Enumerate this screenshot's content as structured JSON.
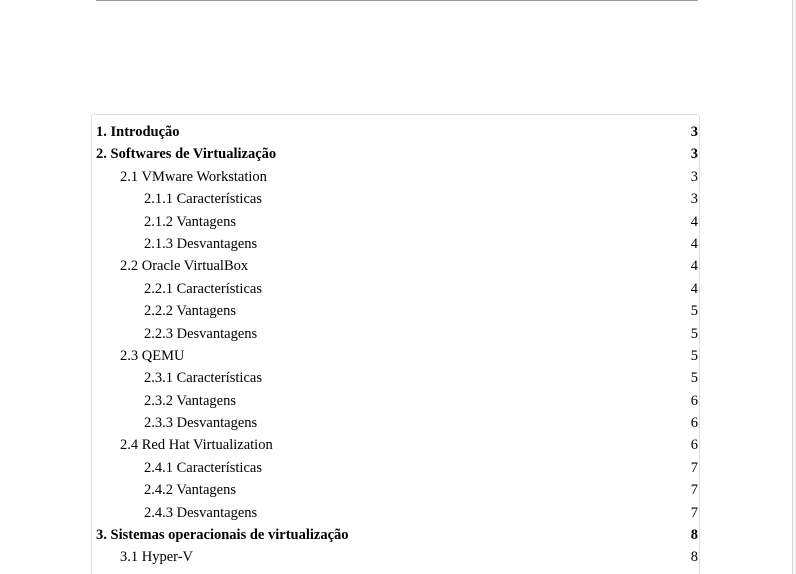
{
  "toc": {
    "entries": [
      {
        "title": "1. Introdução",
        "page": "3"
      },
      {
        "title": "2. Softwares de Virtualização",
        "page": "3"
      },
      {
        "title": "2.1 VMware Workstation",
        "page": "3"
      },
      {
        "title": "2.1.1 Características",
        "page": "3"
      },
      {
        "title": "2.1.2 Vantagens",
        "page": "4"
      },
      {
        "title": "2.1.3 Desvantagens",
        "page": "4"
      },
      {
        "title": "2.2 Oracle VirtualBox",
        "page": "4"
      },
      {
        "title": "2.2.1 Características",
        "page": "4"
      },
      {
        "title": "2.2.2 Vantagens",
        "page": "5"
      },
      {
        "title": "2.2.3 Desvantagens",
        "page": "5"
      },
      {
        "title": "2.3 QEMU",
        "page": "5"
      },
      {
        "title": "2.3.1 Características",
        "page": "5"
      },
      {
        "title": "2.3.2 Vantagens",
        "page": "6"
      },
      {
        "title": "2.3.3 Desvantagens",
        "page": "6"
      },
      {
        "title": "2.4 Red Hat Virtualization",
        "page": "6"
      },
      {
        "title": "2.4.1 Características",
        "page": "7"
      },
      {
        "title": "2.4.2 Vantagens",
        "page": "7"
      },
      {
        "title": "2.4.3 Desvantagens",
        "page": "7"
      },
      {
        "title": "3. Sistemas operacionais de virtualização",
        "page": "8"
      },
      {
        "title": "3.1 Hyper-V",
        "page": "8"
      }
    ]
  }
}
